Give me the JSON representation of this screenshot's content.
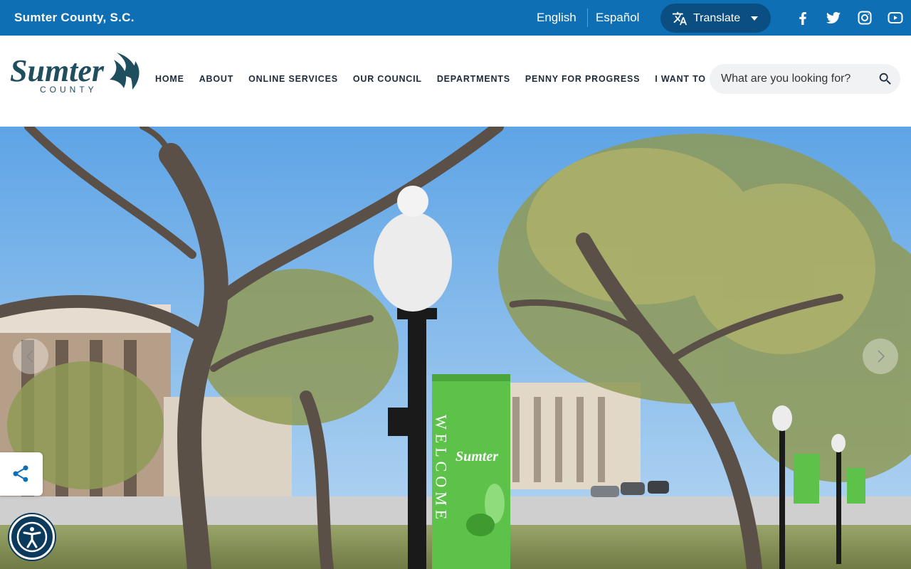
{
  "topbar": {
    "site_name": "Sumter County, S.C.",
    "lang_english": "English",
    "lang_spanish": "Español",
    "translate_label": "Translate",
    "background_color": "#0f6fb5"
  },
  "logo": {
    "text_main": "Sumter",
    "text_sub": "COUNTY",
    "color": "#1f4e5f"
  },
  "nav": {
    "items": [
      "HOME",
      "ABOUT",
      "ONLINE SERVICES",
      "OUR COUNCIL",
      "DEPARTMENTS",
      "PENNY FOR PROGRESS",
      "I WANT TO"
    ]
  },
  "search": {
    "placeholder": "What are you looking for?"
  },
  "hero": {
    "banner_text": "WELCOME",
    "banner_logo_text": "Sumter",
    "banner_color": "#5cc24a"
  },
  "icons": {
    "social": [
      "facebook-icon",
      "twitter-icon",
      "instagram-icon",
      "youtube-icon"
    ],
    "translate": "translate-icon",
    "search": "search-icon",
    "share": "share-icon",
    "accessibility": "accessibility-icon"
  }
}
